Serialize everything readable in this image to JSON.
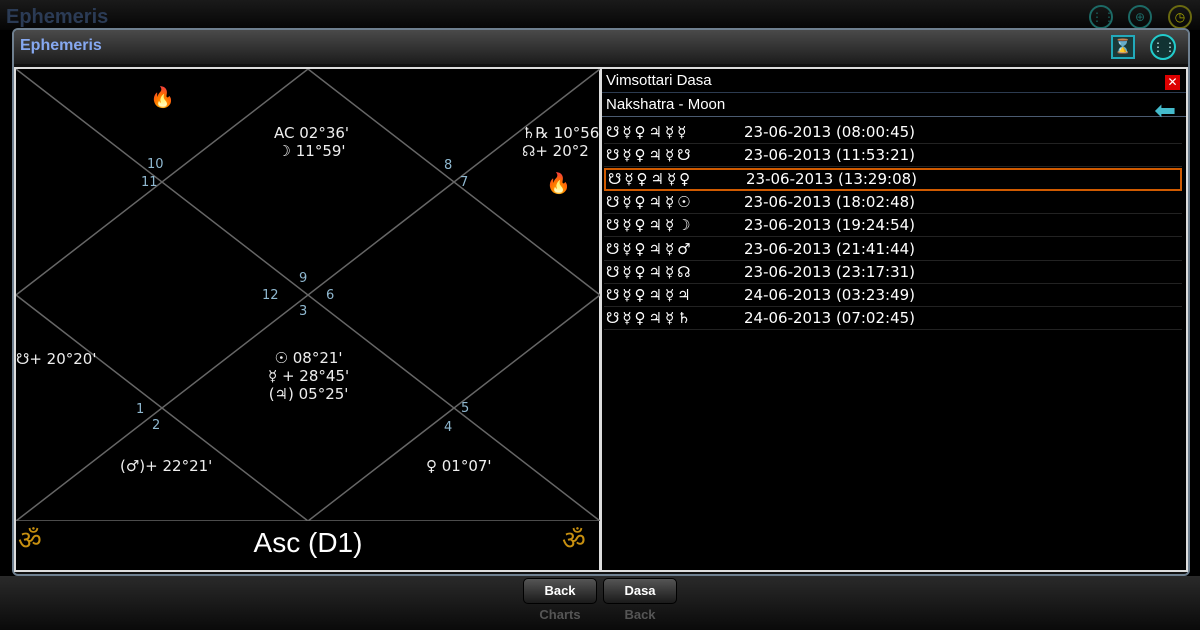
{
  "app_title": "Ephemeris",
  "window_title": "Ephemeris",
  "chart": {
    "title": "Asc (D1)",
    "house_numbers": [
      "1",
      "2",
      "3",
      "4",
      "5",
      "6",
      "7",
      "8",
      "9",
      "10",
      "11",
      "12"
    ],
    "placements": {
      "h1": [
        "AC 02°36'",
        "☽ 11°59'"
      ],
      "h_7": [
        "♄℞ 10°56'",
        "☊+ 20°2"
      ],
      "h_left": "☋+ 20°20'",
      "h_center": [
        "☉ 08°21'",
        "☿ + 28°45'",
        "(♃) 05°25'"
      ],
      "h_bl": "(♂)+ 22°21'",
      "h_br": "♀ 01°07'"
    }
  },
  "dasa": {
    "title": "Vimsottari Dasa",
    "subtitle": "Nakshatra - Moon",
    "rows": [
      {
        "symbols": "☋☿♀♃☿☿",
        "date": "23-06-2013 (08:00:45)"
      },
      {
        "symbols": "☋☿♀♃☿☋",
        "date": "23-06-2013 (11:53:21)"
      },
      {
        "symbols": "☋☿♀♃☿♀",
        "date": "23-06-2013 (13:29:08)",
        "selected": true
      },
      {
        "symbols": "☋☿♀♃☿☉",
        "date": "23-06-2013 (18:02:48)"
      },
      {
        "symbols": "☋☿♀♃☿☽",
        "date": "23-06-2013 (19:24:54)"
      },
      {
        "symbols": "☋☿♀♃☿♂",
        "date": "23-06-2013 (21:41:44)"
      },
      {
        "symbols": "☋☿♀♃☿☊",
        "date": "23-06-2013 (23:17:31)"
      },
      {
        "symbols": "☋☿♀♃☿♃",
        "date": "24-06-2013 (03:23:49)"
      },
      {
        "symbols": "☋☿♀♃☿♄",
        "date": "24-06-2013 (07:02:45)"
      }
    ]
  },
  "buttons": {
    "back_charts": "Back",
    "back_charts_sub": "Charts",
    "dasa_back": "Dasa",
    "dasa_back_sub": "Back"
  },
  "colors": {
    "accent": "#86a8f0",
    "selection": "#d05a00"
  }
}
